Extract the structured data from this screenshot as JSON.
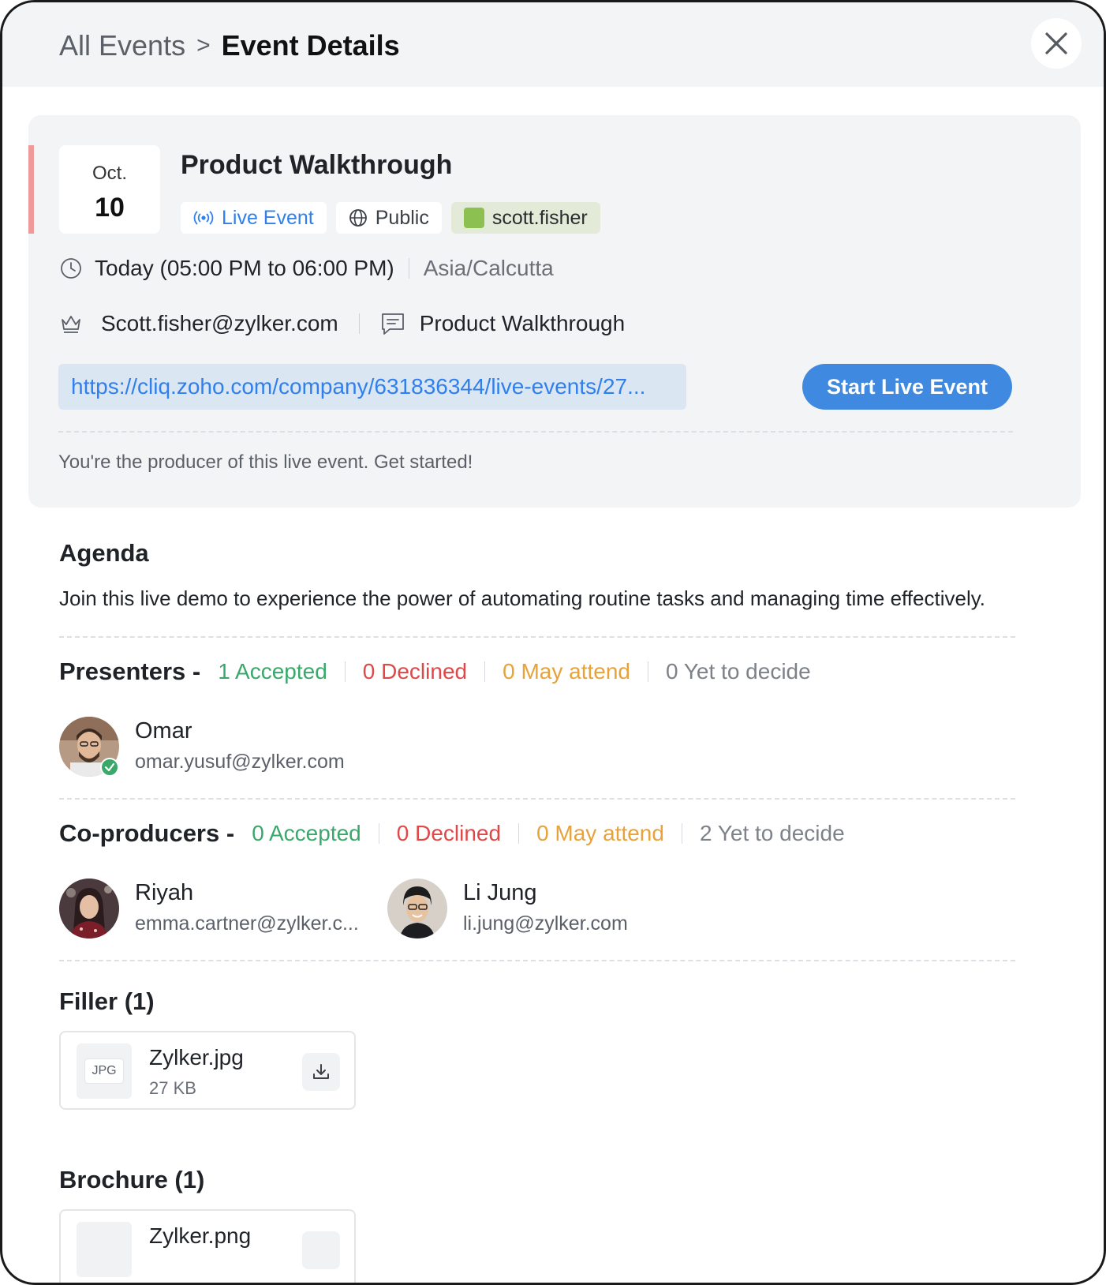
{
  "header": {
    "breadcrumb_parent": "All Events",
    "breadcrumb_separator": ">",
    "breadcrumb_current": "Event Details",
    "close_icon": "close-icon"
  },
  "event": {
    "month": "Oct.",
    "day": "10",
    "title": "Product Walkthrough",
    "chips": {
      "live": "Live Event",
      "visibility": "Public",
      "owner_tag": "scott.fisher"
    },
    "time": "Today (05:00 PM to 06:00 PM)",
    "timezone": "Asia/Calcutta",
    "owner_email": "Scott.fisher@zylker.com",
    "chat_name": "Product Walkthrough",
    "link": "https://cliq.zoho.com/company/631836344/live-events/27...",
    "start_button": "Start Live Event",
    "producer_note": "You're the producer of this live event. Get started!",
    "colors": {
      "accent": "#ef9a9a",
      "live": "#2f80ed",
      "owner_swatch": "#8cc152",
      "start_button": "#3f8ae0"
    }
  },
  "agenda": {
    "title": "Agenda",
    "text": "Join this live demo to experience the power of automating routine tasks and managing time effectively."
  },
  "presenters": {
    "title": "Presenters -",
    "accepted": "1 Accepted",
    "declined": "0 Declined",
    "may_attend": "0 May attend",
    "yet_to_decide": "0 Yet to decide",
    "people": [
      {
        "name": "Omar",
        "email": "omar.yusuf@zylker.com"
      }
    ]
  },
  "coproducers": {
    "title": "Co-producers -",
    "accepted": "0 Accepted",
    "declined": "0 Declined",
    "may_attend": "0 May attend",
    "yet_to_decide": "2 Yet to decide",
    "people": [
      {
        "name": "Riyah",
        "email": "emma.cartner@zylker.c..."
      },
      {
        "name": "Li Jung",
        "email": "li.jung@zylker.com"
      }
    ]
  },
  "filler": {
    "title": "Filler (1)",
    "files": [
      {
        "type": "JPG",
        "name": "Zylker.jpg",
        "size": "27 KB"
      }
    ]
  },
  "brochure": {
    "title": "Brochure (1)",
    "files": [
      {
        "name": "Zylker.png"
      }
    ]
  }
}
